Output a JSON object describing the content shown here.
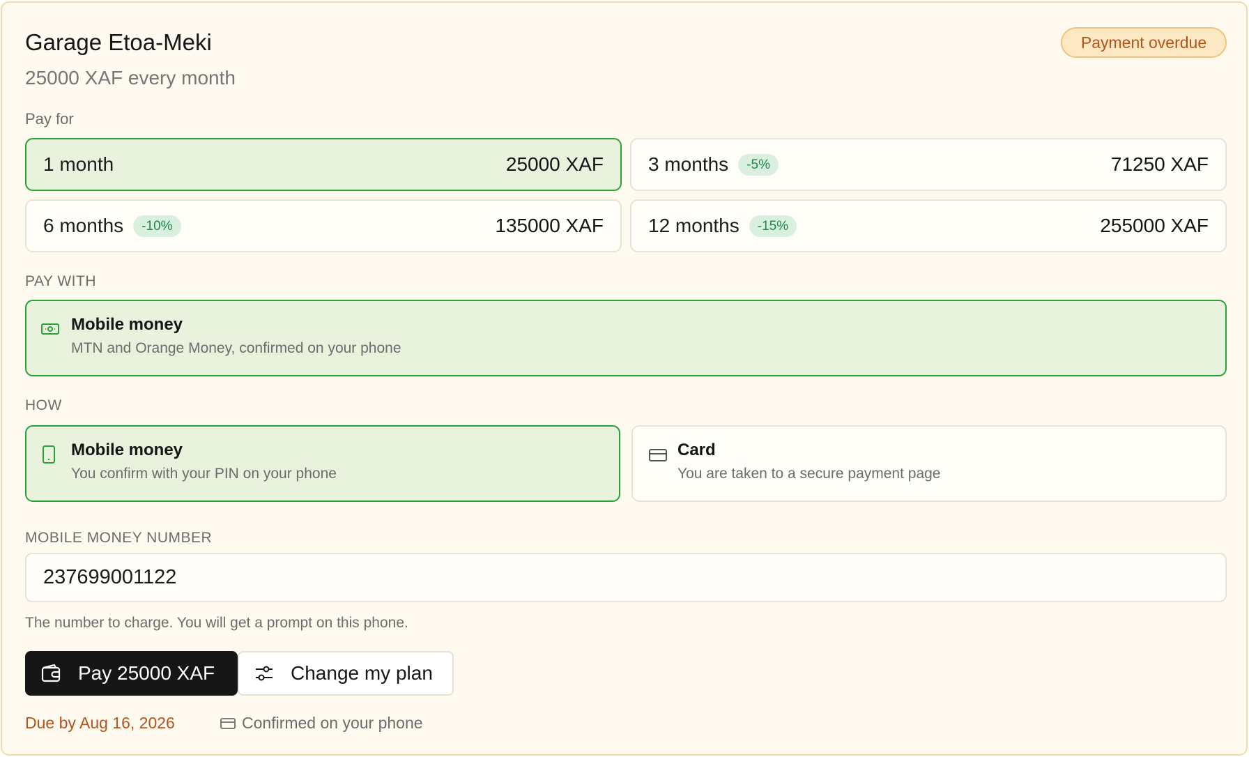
{
  "header": {
    "title": "Garage Etoa-Meki",
    "subtitle": "25000 XAF every month",
    "status_badge": "Payment overdue"
  },
  "pay_for": {
    "label": "Pay for",
    "options": [
      {
        "name": "1 month",
        "discount": "",
        "price": "25000 XAF",
        "selected": true
      },
      {
        "name": "3 months",
        "discount": "-5%",
        "price": "71250 XAF",
        "selected": false
      },
      {
        "name": "6 months",
        "discount": "-10%",
        "price": "135000 XAF",
        "selected": false
      },
      {
        "name": "12 months",
        "discount": "-15%",
        "price": "255000 XAF",
        "selected": false
      }
    ]
  },
  "pay_with": {
    "label": "PAY WITH",
    "option": {
      "title": "Mobile money",
      "description": "MTN and Orange Money, confirmed on your phone",
      "icon": "banknote-icon",
      "selected": true
    }
  },
  "how": {
    "label": "HOW",
    "options": [
      {
        "title": "Mobile money",
        "description": "You confirm with your PIN on your phone",
        "icon": "phone-icon",
        "selected": true
      },
      {
        "title": "Card",
        "description": "You are taken to a secure payment page",
        "icon": "card-icon",
        "selected": false
      }
    ]
  },
  "mobile_number": {
    "label": "MOBILE MONEY NUMBER",
    "value": "237699001122",
    "hint": "The number to charge. You will get a prompt on this phone."
  },
  "actions": {
    "pay_label": "Pay 25000 XAF",
    "change_plan_label": "Change my plan"
  },
  "footer": {
    "due": "Due by Aug 16, 2026",
    "confirmed": "Confirmed on your phone"
  },
  "colors": {
    "accent_green": "#29a038",
    "selected_bg": "#e9f2dd",
    "overdue": "#b5531a",
    "card_bg": "#fefaf0"
  }
}
